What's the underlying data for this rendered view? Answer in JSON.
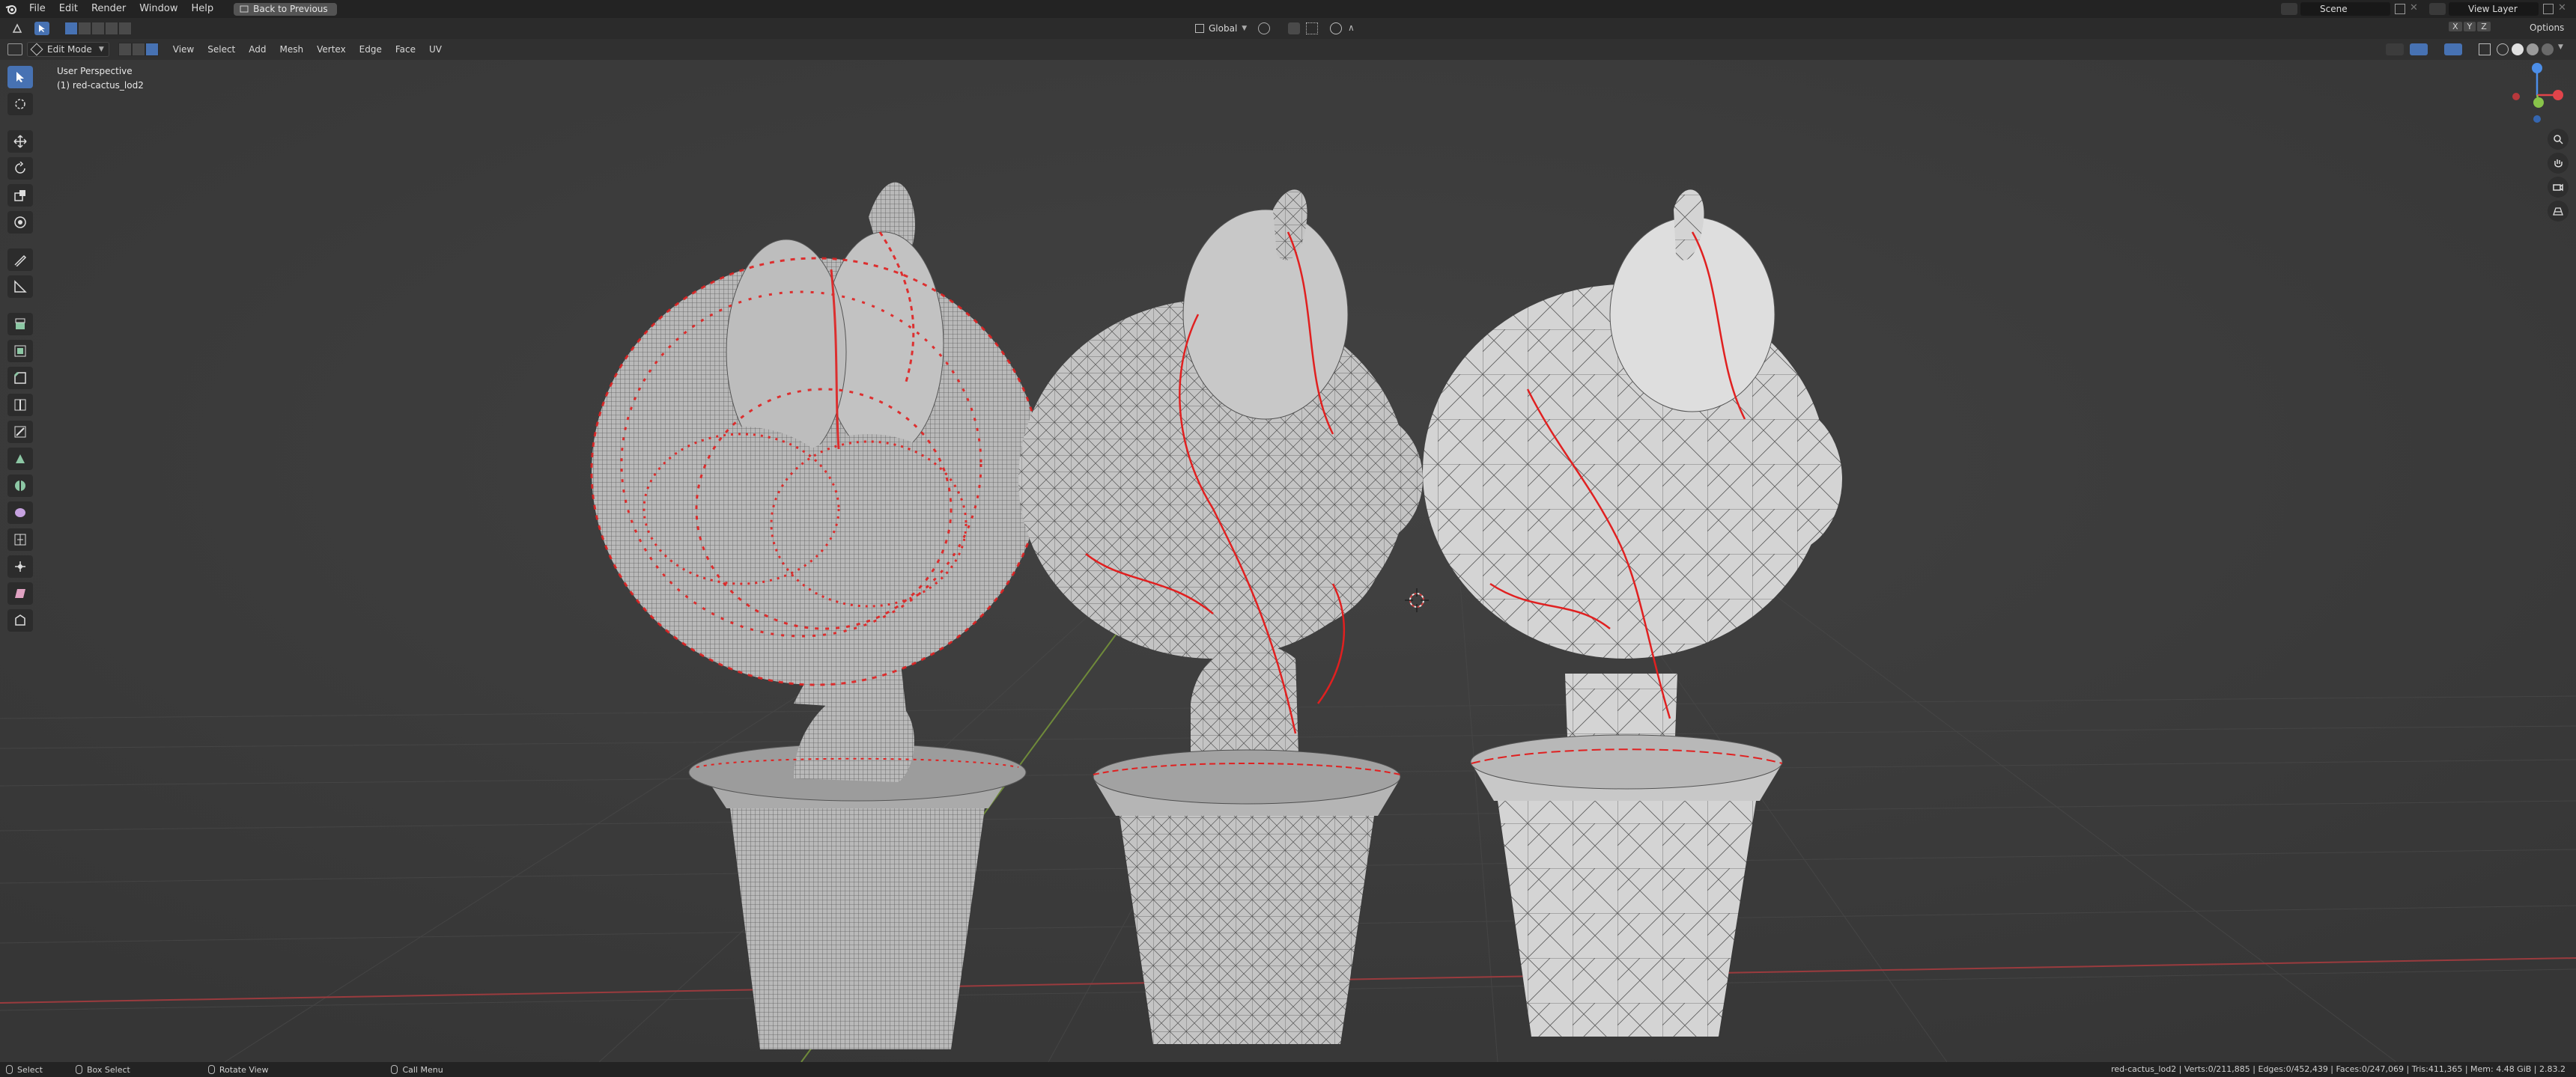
{
  "app": {
    "menus": [
      "File",
      "Edit",
      "Render",
      "Window",
      "Help"
    ],
    "back_button": "Back to Previous",
    "scene": "Scene",
    "view_layer": "View Layer"
  },
  "tool_settings": {
    "orientation": "Global",
    "axes": [
      "X",
      "Y",
      "Z"
    ],
    "options": "Options"
  },
  "viewport_header": {
    "mode": "Edit Mode",
    "menus": [
      "View",
      "Select",
      "Add",
      "Mesh",
      "Vertex",
      "Edge",
      "Face",
      "UV"
    ]
  },
  "viewport": {
    "view_name": "User Perspective",
    "object_name": "(1) red-cactus_lod2"
  },
  "statusbar": {
    "select": "Select",
    "box_select": "Box Select",
    "rotate_view": "Rotate View",
    "call_menu": "Call Menu",
    "stats": "red-cactus_lod2 | Verts:0/211,885 | Edges:0/452,439 | Faces:0/247,069 | Tris:411,365 | Mem: 4.48 GiB | 2.83.2"
  },
  "colors": {
    "accent": "#4772b3",
    "seam": "#e02020",
    "axis_x": "#e0444a",
    "axis_y": "#88c34a",
    "axis_z": "#4c8ee8"
  },
  "icons": {
    "toolbar": [
      "select-box-icon",
      "cursor-icon",
      "move-icon",
      "rotate-icon",
      "scale-icon",
      "transform-icon",
      "annotate-icon",
      "measure-icon",
      "extrude-icon",
      "inset-icon",
      "bevel-icon",
      "loop-cut-icon",
      "knife-icon",
      "poly-build-icon",
      "spin-icon",
      "smooth-icon",
      "edge-slide-icon",
      "shrink-fatten-icon",
      "shear-icon",
      "rip-icon"
    ]
  }
}
